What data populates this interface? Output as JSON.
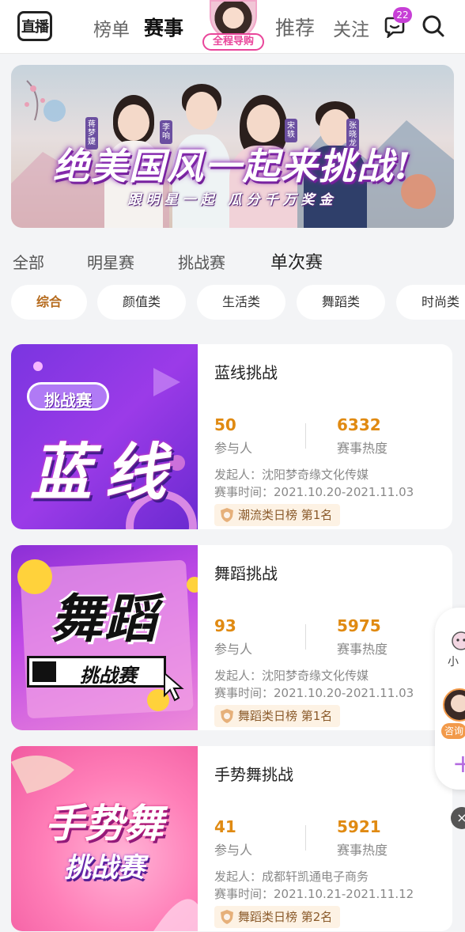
{
  "header": {
    "logo_text": "直播",
    "nav": [
      "榜单",
      "赛事",
      "推荐",
      "关注"
    ],
    "guide_label": "全程导购",
    "message_badge": "22",
    "icons": [
      "message-icon",
      "search-icon"
    ]
  },
  "banner": {
    "title": "绝美国风一起来挑战!",
    "subtitle": "跟明星一起 瓜分千万奖金",
    "name_tags": [
      "蒋梦婕",
      "李响",
      "宋轶",
      "张晓龙"
    ]
  },
  "tabs": {
    "items": [
      "全部",
      "明星赛",
      "挑战赛",
      "单次赛"
    ],
    "active": "单次赛"
  },
  "chips": {
    "items": [
      "综合",
      "颜值类",
      "生活类",
      "舞蹈类",
      "时尚类"
    ],
    "active": "综合"
  },
  "events": [
    {
      "title": "蓝线挑战",
      "participants": "50",
      "participants_label": "参与人",
      "heat": "6332",
      "heat_label": "赛事热度",
      "organizer": "发起人：沈阳梦奇缘文化传媒",
      "time": "赛事时间：2021.10.20-2021.11.03",
      "rank": "潮流类日榜 第1名",
      "image_text_top": "挑战赛",
      "image_text_main": "蓝线"
    },
    {
      "title": "舞蹈挑战",
      "participants": "93",
      "participants_label": "参与人",
      "heat": "5975",
      "heat_label": "赛事热度",
      "organizer": "发起人：沈阳梦奇缘文化传媒",
      "time": "赛事时间：2021.10.20-2021.11.03",
      "rank": "舞蹈类日榜 第1名",
      "image_text_main": "舞蹈",
      "image_text_sub": "挑战赛"
    },
    {
      "title": "手势舞挑战",
      "participants": "41",
      "participants_label": "参与人",
      "heat": "5921",
      "heat_label": "赛事热度",
      "organizer": "发起人：成都轩凯通电子商务",
      "time": "赛事时间：2021.10.21-2021.11.12",
      "rank": "舞蹈类日榜 第2名",
      "image_text_main": "手势舞",
      "image_text_sub": "挑战赛"
    }
  ],
  "float_widget": {
    "label_top": "小",
    "label_mid": "咨询",
    "plus": "+",
    "close": "×"
  }
}
